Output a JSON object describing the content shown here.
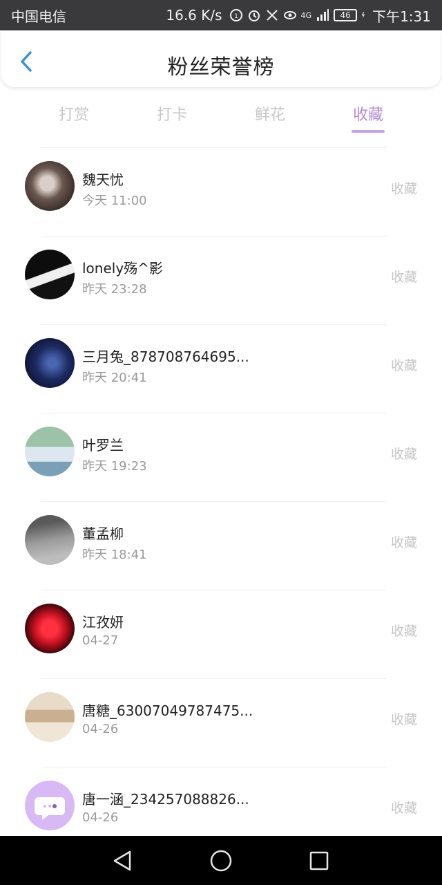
{
  "status_bar": {
    "carrier": "中国电信",
    "speed": "16.6 K/s",
    "network": "4G",
    "battery": "46",
    "time": "下午1:31"
  },
  "header": {
    "title": "粉丝荣誉榜",
    "back_icon": "chevron-left-icon",
    "accent_color": "#3a8fe0"
  },
  "tabs": [
    {
      "label": "打赏",
      "active": false
    },
    {
      "label": "打卡",
      "active": false
    },
    {
      "label": "鲜花",
      "active": false
    },
    {
      "label": "收藏",
      "active": true
    }
  ],
  "tab_active_color": "#b28ad8",
  "fans": [
    {
      "name": "魏天忧",
      "time": "今天 11:00",
      "action": "收藏",
      "avatar_color": "#4a3a35"
    },
    {
      "name": "lonely殇^影",
      "time": "昨天 23:28",
      "action": "收藏",
      "avatar_color": "#1a1a1a"
    },
    {
      "name": "三月兔_878708764695...",
      "time": "昨天 20:41",
      "action": "收藏",
      "avatar_color": "#15203f"
    },
    {
      "name": "叶罗兰",
      "time": "昨天 19:23",
      "action": "收藏",
      "avatar_color": "#7aa88a"
    },
    {
      "name": "董孟柳",
      "time": "昨天 18:41",
      "action": "收藏",
      "avatar_color": "#8a8a8a"
    },
    {
      "name": "江孜妍",
      "time": "04-27",
      "action": "收藏",
      "avatar_color": "#b01020"
    },
    {
      "name": "唐糖_63007049787475...",
      "time": "04-26",
      "action": "收藏",
      "avatar_color": "#d8c7b0"
    },
    {
      "name": "唐一涵_234257088826...",
      "time": "04-26",
      "action": "收藏",
      "avatar_color": "#d8b8f5"
    }
  ],
  "navigation_bar": {
    "back_icon": "nav-back-icon",
    "home_icon": "nav-home-icon",
    "recent_icon": "nav-recent-icon"
  }
}
